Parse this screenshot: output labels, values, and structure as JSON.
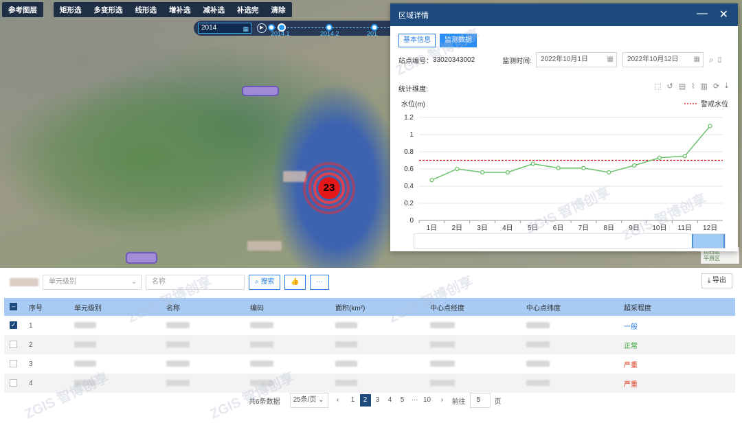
{
  "toolbar": {
    "left": "参考图层",
    "items": [
      "矩形选",
      "多变形选",
      "线形选",
      "增补选",
      "减补选",
      "补选完",
      "清除"
    ]
  },
  "timeline": {
    "year": "2014",
    "points": [
      "2014.1",
      "2014.2",
      "201"
    ]
  },
  "marker": {
    "count": "23"
  },
  "map_legend": [
    "山西区",
    "平原区"
  ],
  "dialog": {
    "title": "区域详情",
    "tabs": [
      "基本信息",
      "监测数据"
    ],
    "station_label": "站点编号：",
    "station_value": "33020343002",
    "time_label": "监测时间:",
    "date_start": "2022年10月1日",
    "date_end": "2022年10月12日",
    "stat_label": "统计维度:"
  },
  "chart_data": {
    "type": "line",
    "ylabel": "水位(m)",
    "categories": [
      "1日",
      "2日",
      "3日",
      "4日",
      "5日",
      "6日",
      "7日",
      "8日",
      "9日",
      "10日",
      "11日",
      "12日"
    ],
    "series": [
      {
        "values": [
          0.47,
          0.6,
          0.56,
          0.56,
          0.66,
          0.61,
          0.61,
          0.56,
          0.64,
          0.73,
          0.75,
          1.1
        ],
        "color": "#6cc06c"
      }
    ],
    "threshold": {
      "name": "警戒水位",
      "value": 0.7,
      "color": "#e02020"
    },
    "ylim": [
      0,
      1.2
    ],
    "yticks": [
      "0",
      "0.2",
      "0.4",
      "0.6",
      "0.8",
      "1",
      "1.2"
    ],
    "grid": true,
    "legend": "top-right"
  },
  "panel": {
    "unit_level_placeholder": "单元级别",
    "name_placeholder": "名称",
    "search_label": "搜索",
    "export_label": "导出",
    "columns": [
      "序号",
      "单元级别",
      "名称",
      "编码",
      "面积(km²)",
      "中心点经度",
      "中心点纬度",
      "超采程度"
    ],
    "rows": [
      {
        "index": "1",
        "level": "一般",
        "level_color": "#2a7de0",
        "checked": true
      },
      {
        "index": "2",
        "level": "正常",
        "level_color": "#2aa52a",
        "checked": false
      },
      {
        "index": "3",
        "level": "严重",
        "level_color": "#e04020",
        "checked": false
      },
      {
        "index": "4",
        "level": "严重",
        "level_color": "#e04020",
        "checked": false
      }
    ],
    "pager": {
      "total": "共6条数据",
      "page_size": "25条/页",
      "pages": [
        "1",
        "2",
        "3",
        "4",
        "5",
        "···",
        "10"
      ],
      "active_page": "2",
      "goto_label": "前往",
      "goto_value": "5",
      "goto_suffix": "页"
    }
  }
}
